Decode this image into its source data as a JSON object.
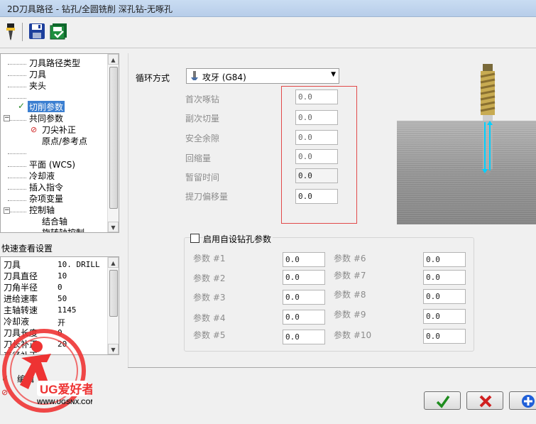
{
  "window": {
    "title": "2D刀具路径 - 钻孔/全圆铣削 深孔钻-无啄孔"
  },
  "tree": {
    "items": [
      {
        "label": "刀具路径类型",
        "state": ""
      },
      {
        "label": "刀具",
        "state": ""
      },
      {
        "label": "夹头",
        "state": ""
      },
      {
        "label": "切削参数",
        "state": "selected"
      },
      {
        "label": "共同参数",
        "state": ""
      },
      {
        "label": "刀尖补正",
        "state": "error"
      },
      {
        "label": "原点/参考点",
        "state": ""
      },
      {
        "label": "平面 (WCS)",
        "state": ""
      },
      {
        "label": "冷却液",
        "state": ""
      },
      {
        "label": "插入指令",
        "state": ""
      },
      {
        "label": "杂项变量",
        "state": ""
      },
      {
        "label": "控制轴",
        "state": ""
      },
      {
        "label": "结合轴",
        "state": ""
      },
      {
        "label": "旋转轴控制",
        "state": ""
      }
    ]
  },
  "quickview": {
    "title": "快速查看设置",
    "rows": [
      {
        "k": "刀具",
        "v": "10. DRILL"
      },
      {
        "k": "刀具直径",
        "v": "10"
      },
      {
        "k": "刀角半径",
        "v": "0"
      },
      {
        "k": "进给速率",
        "v": "50"
      },
      {
        "k": "主轴转速",
        "v": "1145"
      },
      {
        "k": "冷却液",
        "v": "开"
      },
      {
        "k": "刀具长度",
        "v": "0"
      },
      {
        "k": "刀长补正",
        "v": "20"
      },
      {
        "k": "直径补正",
        "v": ""
      }
    ]
  },
  "bottom_left": {
    "edit_label": "编辑"
  },
  "watermark": {
    "brand": "UG爱好者",
    "url": "WWW.UGSNX.COM"
  },
  "cycle": {
    "label": "循环方式",
    "value": "攻牙 (G84)"
  },
  "params": [
    {
      "label": "首次啄钻",
      "value": "0.0"
    },
    {
      "label": "副次切量",
      "value": "0.0"
    },
    {
      "label": "安全余隙",
      "value": "0.0"
    },
    {
      "label": "回缩量",
      "value": "0.0"
    },
    {
      "label": "暂留时间",
      "value": "0.0"
    },
    {
      "label": "提刀偏移量",
      "value": "0.0"
    }
  ],
  "custom": {
    "checkbox_label": "启用自设钻孔参数",
    "checked": false,
    "left": [
      {
        "label": "参数 #1",
        "value": "0.0"
      },
      {
        "label": "参数 #2",
        "value": "0.0"
      },
      {
        "label": "参数 #3",
        "value": "0.0"
      },
      {
        "label": "参数 #4",
        "value": "0.0"
      },
      {
        "label": "参数 #5",
        "value": "0.0"
      }
    ],
    "right": [
      {
        "label": "参数 #6",
        "value": "0.0"
      },
      {
        "label": "参数 #7",
        "value": "0.0"
      },
      {
        "label": "参数 #8",
        "value": "0.0"
      },
      {
        "label": "参数 #9",
        "value": "0.0"
      },
      {
        "label": "参数 #10",
        "value": "0.0"
      }
    ]
  },
  "colors": {
    "ok": "#1e8c1e",
    "cancel": "#d02020",
    "help": "#1f5fd8",
    "highlight": "#3b7fd1",
    "redbox": "#e24a4a"
  }
}
